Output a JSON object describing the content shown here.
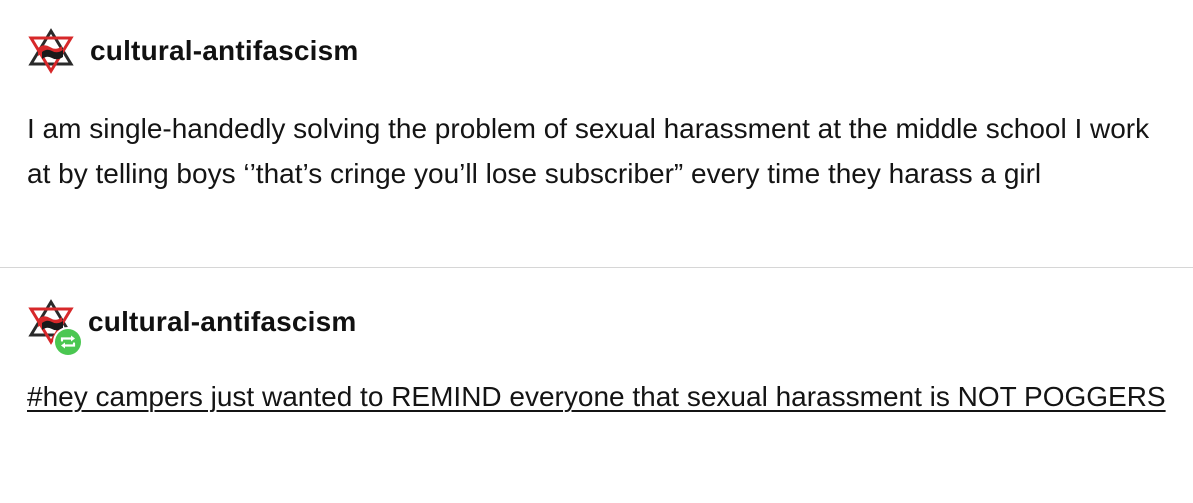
{
  "original_post": {
    "username": "cultural-antifascism",
    "avatar_icon": "hexagram-antifa-flag-icon",
    "body": "I am single-handedly solving the problem of sexual harassment at the middle school I work at by telling boys ‘’that’s cringe you’ll lose subscriber” every time they harass a girl"
  },
  "reblog_post": {
    "username": "cultural-antifascism",
    "avatar_icon": "hexagram-antifa-flag-icon",
    "badge_icon": "reblog-icon",
    "tag": "#hey campers just wanted to REMIND everyone that sexual harassment is NOT POGGERS"
  },
  "colors": {
    "divider": "#d6d6d6",
    "reblog_badge": "#4ac751",
    "avatar_red": "#d7282a",
    "avatar_dark": "#2a2a2a"
  }
}
